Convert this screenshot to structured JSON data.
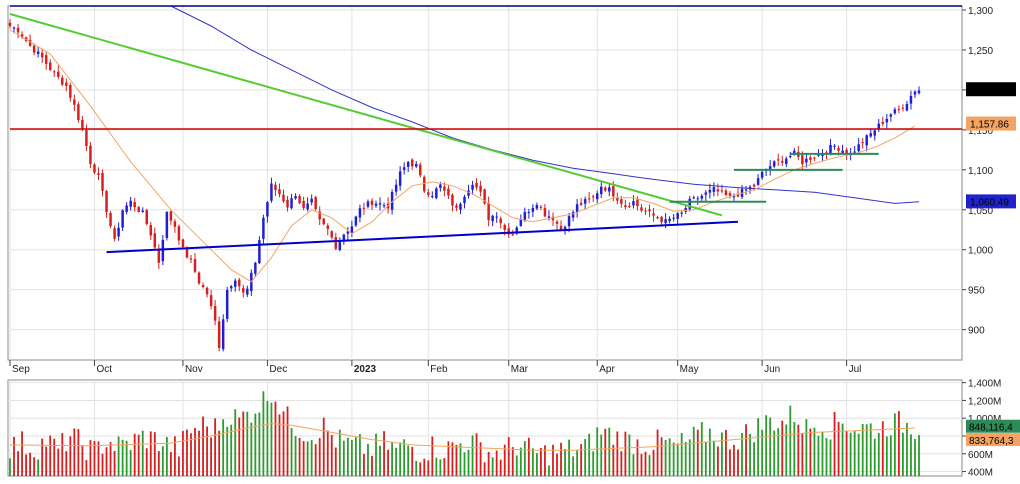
{
  "chart_data": [
    {
      "type": "candlestick",
      "panel": "price",
      "y_ticks": [
        "1,300",
        "1,250",
        "1,200",
        "1,150",
        "1,100",
        "1,050",
        "1,000",
        "950",
        "900"
      ],
      "y_tick_values": [
        1300,
        1250,
        1200,
        1150,
        1100,
        1050,
        1000,
        950,
        900
      ],
      "ylim": [
        862,
        1305
      ],
      "x_months": [
        {
          "label": "Sep",
          "day": 0
        },
        {
          "label": "Oct",
          "day": 21
        },
        {
          "label": "Nov",
          "day": 43
        },
        {
          "label": "Dec",
          "day": 64
        },
        {
          "label": "2023",
          "day": 85,
          "bold": true
        },
        {
          "label": "Feb",
          "day": 104
        },
        {
          "label": "Mar",
          "day": 124
        },
        {
          "label": "Apr",
          "day": 146
        },
        {
          "label": "May",
          "day": 166
        },
        {
          "label": "Jun",
          "day": 187
        },
        {
          "label": "Jul",
          "day": 208
        }
      ],
      "days": 226,
      "close_anchors": [
        [
          0,
          1280
        ],
        [
          2,
          1275
        ],
        [
          5,
          1255
        ],
        [
          8,
          1240
        ],
        [
          11,
          1220
        ],
        [
          14,
          1205
        ],
        [
          16,
          1180
        ],
        [
          18,
          1150
        ],
        [
          20,
          1110
        ],
        [
          22,
          1090
        ],
        [
          24,
          1050
        ],
        [
          26,
          1010
        ],
        [
          28,
          1050
        ],
        [
          30,
          1060
        ],
        [
          33,
          1045
        ],
        [
          35,
          1020
        ],
        [
          37,
          985
        ],
        [
          39,
          1045
        ],
        [
          41,
          1030
        ],
        [
          43,
          1000
        ],
        [
          45,
          985
        ],
        [
          47,
          960
        ],
        [
          49,
          945
        ],
        [
          51,
          910
        ],
        [
          52,
          880
        ],
        [
          54,
          950
        ],
        [
          56,
          965
        ],
        [
          58,
          945
        ],
        [
          59,
          950
        ],
        [
          61,
          985
        ],
        [
          63,
          1040
        ],
        [
          65,
          1080
        ],
        [
          67,
          1070
        ],
        [
          69,
          1055
        ],
        [
          71,
          1070
        ],
        [
          73,
          1050
        ],
        [
          75,
          1060
        ],
        [
          77,
          1035
        ],
        [
          79,
          1025
        ],
        [
          81,
          1005
        ],
        [
          83,
          1020
        ],
        [
          85,
          1030
        ],
        [
          87,
          1050
        ],
        [
          90,
          1060
        ],
        [
          94,
          1055
        ],
        [
          97,
          1095
        ],
        [
          99,
          1110
        ],
        [
          101,
          1105
        ],
        [
          103,
          1075
        ],
        [
          105,
          1070
        ],
        [
          107,
          1080
        ],
        [
          109,
          1065
        ],
        [
          111,
          1050
        ],
        [
          113,
          1070
        ],
        [
          115,
          1085
        ],
        [
          117,
          1070
        ],
        [
          119,
          1040
        ],
        [
          121,
          1045
        ],
        [
          123,
          1025
        ],
        [
          125,
          1020
        ],
        [
          127,
          1040
        ],
        [
          129,
          1050
        ],
        [
          131,
          1060
        ],
        [
          133,
          1045
        ],
        [
          135,
          1040
        ],
        [
          137,
          1025
        ],
        [
          139,
          1040
        ],
        [
          141,
          1055
        ],
        [
          143,
          1060
        ],
        [
          145,
          1065
        ],
        [
          147,
          1080
        ],
        [
          149,
          1075
        ],
        [
          151,
          1065
        ],
        [
          153,
          1055
        ],
        [
          155,
          1060
        ],
        [
          157,
          1050
        ],
        [
          159,
          1045
        ],
        [
          161,
          1040
        ],
        [
          163,
          1035
        ],
        [
          165,
          1040
        ],
        [
          167,
          1045
        ],
        [
          169,
          1060
        ],
        [
          171,
          1065
        ],
        [
          173,
          1070
        ],
        [
          175,
          1075
        ],
        [
          177,
          1070
        ],
        [
          179,
          1065
        ],
        [
          181,
          1070
        ],
        [
          183,
          1075
        ],
        [
          185,
          1080
        ],
        [
          187,
          1095
        ],
        [
          189,
          1105
        ],
        [
          191,
          1110
        ],
        [
          193,
          1115
        ],
        [
          195,
          1120
        ],
        [
          197,
          1110
        ],
        [
          199,
          1115
        ],
        [
          201,
          1120
        ],
        [
          203,
          1125
        ],
        [
          205,
          1130
        ],
        [
          207,
          1125
        ],
        [
          209,
          1120
        ],
        [
          211,
          1130
        ],
        [
          213,
          1140
        ],
        [
          215,
          1150
        ],
        [
          217,
          1160
        ],
        [
          219,
          1170
        ],
        [
          221,
          1175
        ],
        [
          223,
          1185
        ],
        [
          225,
          1200
        ]
      ],
      "moving_average_short": {
        "color": "#f4a460",
        "points": [
          [
            0,
            1275
          ],
          [
            10,
            1245
          ],
          [
            20,
            1180
          ],
          [
            30,
            1110
          ],
          [
            40,
            1050
          ],
          [
            50,
            1000
          ],
          [
            55,
            975
          ],
          [
            60,
            960
          ],
          [
            65,
            990
          ],
          [
            70,
            1030
          ],
          [
            75,
            1050
          ],
          [
            80,
            1040
          ],
          [
            85,
            1020
          ],
          [
            90,
            1035
          ],
          [
            95,
            1060
          ],
          [
            100,
            1080
          ],
          [
            105,
            1085
          ],
          [
            110,
            1080
          ],
          [
            115,
            1070
          ],
          [
            120,
            1055
          ],
          [
            125,
            1040
          ],
          [
            130,
            1035
          ],
          [
            135,
            1040
          ],
          [
            140,
            1045
          ],
          [
            145,
            1055
          ],
          [
            150,
            1065
          ],
          [
            155,
            1065
          ],
          [
            160,
            1058
          ],
          [
            165,
            1048
          ],
          [
            170,
            1050
          ],
          [
            175,
            1060
          ],
          [
            180,
            1068
          ],
          [
            185,
            1075
          ],
          [
            190,
            1088
          ],
          [
            195,
            1100
          ],
          [
            200,
            1108
          ],
          [
            205,
            1115
          ],
          [
            210,
            1120
          ],
          [
            215,
            1128
          ],
          [
            220,
            1140
          ],
          [
            225,
            1155
          ]
        ]
      },
      "moving_average_long": {
        "color": "#3333cc",
        "points": [
          [
            40,
            1305
          ],
          [
            50,
            1280
          ],
          [
            60,
            1250
          ],
          [
            70,
            1225
          ],
          [
            80,
            1200
          ],
          [
            90,
            1178
          ],
          [
            100,
            1160
          ],
          [
            110,
            1140
          ],
          [
            120,
            1125
          ],
          [
            130,
            1112
          ],
          [
            140,
            1102
          ],
          [
            150,
            1095
          ],
          [
            160,
            1088
          ],
          [
            170,
            1082
          ],
          [
            180,
            1078
          ],
          [
            190,
            1075
          ],
          [
            200,
            1072
          ],
          [
            210,
            1065
          ],
          [
            220,
            1058
          ],
          [
            226,
            1060
          ]
        ]
      },
      "trend_lines": [
        {
          "color": "#0000cc",
          "from": [
            24,
            997
          ],
          "to": [
            181,
            1035
          ],
          "label": "support"
        },
        {
          "color": "#55cc33",
          "from": [
            0,
            1295
          ],
          "to": [
            177,
            1043
          ],
          "label": "downtrend"
        },
        {
          "color": "#cc0000",
          "from": [
            0,
            1151
          ],
          "to": [
            238,
            1151
          ],
          "label": "horizontal"
        },
        {
          "color": "#000080",
          "from": [
            0,
            1305
          ],
          "to": [
            238,
            1305
          ],
          "label": "top"
        },
        {
          "color": "#2e8b57",
          "from": [
            164,
            1060
          ],
          "to": [
            188,
            1060
          ],
          "label": "range"
        },
        {
          "color": "#2e8b57",
          "from": [
            180,
            1100
          ],
          "to": [
            207,
            1100
          ],
          "label": "range"
        },
        {
          "color": "#2e8b57",
          "from": [
            194,
            1120
          ],
          "to": [
            216,
            1120
          ],
          "label": "range"
        }
      ],
      "price_flags": [
        {
          "text": "1,200.84",
          "value": 1200.84,
          "bg": "#000000",
          "fg": "#ffffff"
        },
        {
          "text": "1,157.86",
          "value": 1157.86,
          "bg": "#f4a460",
          "fg": "#000000"
        },
        {
          "text": "1,060.49",
          "value": 1060.49,
          "bg": "#2222cc",
          "fg": "#ffffff"
        }
      ]
    },
    {
      "type": "bar",
      "panel": "volume",
      "y_ticks": [
        "1,400M",
        "1,200M",
        "1,000M",
        "800M",
        "600M",
        "400M"
      ],
      "y_tick_values": [
        1400,
        1200,
        1000,
        800,
        600,
        400
      ],
      "ylim": [
        350,
        1430
      ],
      "unit": "M",
      "volume_anchors": [
        [
          0,
          680
        ],
        [
          3,
          720
        ],
        [
          6,
          650
        ],
        [
          9,
          750
        ],
        [
          12,
          640
        ],
        [
          15,
          800
        ],
        [
          18,
          700
        ],
        [
          21,
          620
        ],
        [
          24,
          750
        ],
        [
          27,
          680
        ],
        [
          30,
          720
        ],
        [
          33,
          790
        ],
        [
          36,
          760
        ],
        [
          39,
          700
        ],
        [
          42,
          660
        ],
        [
          45,
          860
        ],
        [
          48,
          920
        ],
        [
          51,
          880
        ],
        [
          54,
          1050
        ],
        [
          57,
          980
        ],
        [
          60,
          1080
        ],
        [
          63,
          1200
        ],
        [
          65,
          1320
        ],
        [
          67,
          1150
        ],
        [
          69,
          990
        ],
        [
          72,
          880
        ],
        [
          75,
          810
        ],
        [
          78,
          900
        ],
        [
          81,
          760
        ],
        [
          84,
          700
        ],
        [
          87,
          680
        ],
        [
          90,
          660
        ],
        [
          93,
          720
        ],
        [
          96,
          650
        ],
        [
          99,
          700
        ],
        [
          102,
          620
        ],
        [
          105,
          680
        ],
        [
          108,
          640
        ],
        [
          111,
          700
        ],
        [
          114,
          740
        ],
        [
          117,
          680
        ],
        [
          120,
          600
        ],
        [
          123,
          640
        ],
        [
          126,
          700
        ],
        [
          129,
          640
        ],
        [
          132,
          600
        ],
        [
          135,
          620
        ],
        [
          138,
          640
        ],
        [
          141,
          650
        ],
        [
          144,
          700
        ],
        [
          147,
          860
        ],
        [
          150,
          800
        ],
        [
          153,
          760
        ],
        [
          156,
          720
        ],
        [
          159,
          700
        ],
        [
          162,
          740
        ],
        [
          165,
          680
        ],
        [
          168,
          720
        ],
        [
          171,
          800
        ],
        [
          174,
          840
        ],
        [
          177,
          780
        ],
        [
          180,
          760
        ],
        [
          183,
          820
        ],
        [
          186,
          900
        ],
        [
          189,
          980
        ],
        [
          192,
          950
        ],
        [
          195,
          1050
        ],
        [
          198,
          880
        ],
        [
          201,
          950
        ],
        [
          204,
          900
        ],
        [
          207,
          980
        ],
        [
          210,
          880
        ],
        [
          213,
          900
        ],
        [
          216,
          880
        ],
        [
          219,
          940
        ],
        [
          222,
          940
        ],
        [
          225,
          900
        ]
      ],
      "volume_ma": {
        "color": "#f4a460",
        "points": [
          [
            0,
            700
          ],
          [
            20,
            690
          ],
          [
            40,
            720
          ],
          [
            50,
            800
          ],
          [
            60,
            900
          ],
          [
            65,
            940
          ],
          [
            70,
            920
          ],
          [
            80,
            840
          ],
          [
            90,
            760
          ],
          [
            100,
            700
          ],
          [
            110,
            680
          ],
          [
            120,
            660
          ],
          [
            130,
            640
          ],
          [
            140,
            640
          ],
          [
            150,
            660
          ],
          [
            160,
            680
          ],
          [
            170,
            720
          ],
          [
            180,
            760
          ],
          [
            190,
            800
          ],
          [
            200,
            840
          ],
          [
            210,
            860
          ],
          [
            220,
            880
          ],
          [
            225,
            890
          ]
        ]
      },
      "volume_flags": [
        {
          "text": "848,116,4",
          "value": 848,
          "bg": "#2e8b57",
          "fg": "#ffffff"
        },
        {
          "text": "833,764,3",
          "value": 833,
          "bg": "#f4a460",
          "fg": "#000000"
        }
      ]
    }
  ]
}
